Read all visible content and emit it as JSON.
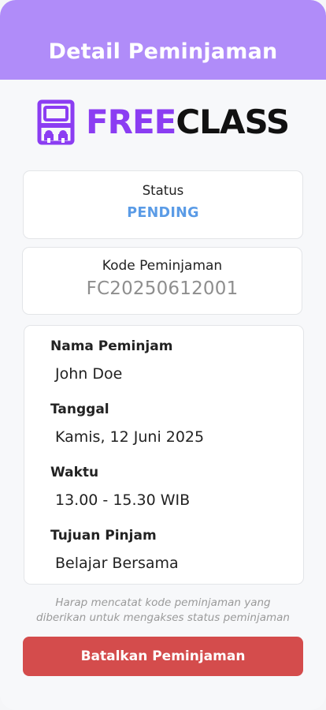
{
  "header": {
    "title": "Detail Peminjaman"
  },
  "brand": {
    "part1": "FREE",
    "part2": "CLASS",
    "icon": "classroom-logo-icon"
  },
  "status": {
    "label": "Status",
    "value": "PENDING"
  },
  "code": {
    "label": "Kode Peminjaman",
    "value": "FC20250612001"
  },
  "details": [
    {
      "label": "Nama Peminjam",
      "value": "John Doe"
    },
    {
      "label": "Tanggal",
      "value": "Kamis, 12 Juni 2025"
    },
    {
      "label": "Waktu",
      "value": "13.00 - 15.30 WIB"
    },
    {
      "label": "Tujuan Pinjam",
      "value": "Belajar Bersama"
    }
  ],
  "note": {
    "line1": "Harap mencatat kode peminjaman yang",
    "line2": "diberikan untuk mengakses status peminjaman"
  },
  "actions": {
    "cancel_label": "Batalkan Peminjaman"
  },
  "colors": {
    "header": "#b08cf9",
    "brand_purple": "#8b3df2",
    "status_pending": "#5a9be6",
    "danger": "#d44c4c"
  }
}
